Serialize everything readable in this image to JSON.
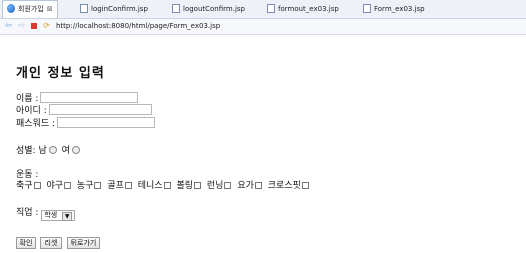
{
  "tabs": [
    {
      "label": "회원가입",
      "icon": "globe-icon",
      "active": true
    },
    {
      "label": "loginConfirm.jsp",
      "icon": "file-icon"
    },
    {
      "label": "logoutConfirm.jsp",
      "icon": "file-icon"
    },
    {
      "label": "formout_ex03.jsp",
      "icon": "file-icon"
    },
    {
      "label": "Form_ex03.jsp",
      "icon": "file-icon"
    }
  ],
  "tab_close": "⊠",
  "url": "http://localhost:8080/html/page/Form_ex03.jsp",
  "form": {
    "title": "개인 정보 입력",
    "name_label": "이름 :",
    "id_label": "아이디 :",
    "password_label": "패스워드 :",
    "gender_label": "성별:",
    "male": "남",
    "female": "여",
    "sports_label": "운동 :",
    "sports": [
      "축구",
      "야구",
      "농구",
      "골프",
      "테니스",
      "볼링",
      "런닝",
      "요가",
      "크로스핏"
    ],
    "job_label": "직업 :",
    "job_selected": "학생",
    "buttons": {
      "ok": "확인",
      "reset": "리셋",
      "back": "뒤로가기"
    }
  }
}
